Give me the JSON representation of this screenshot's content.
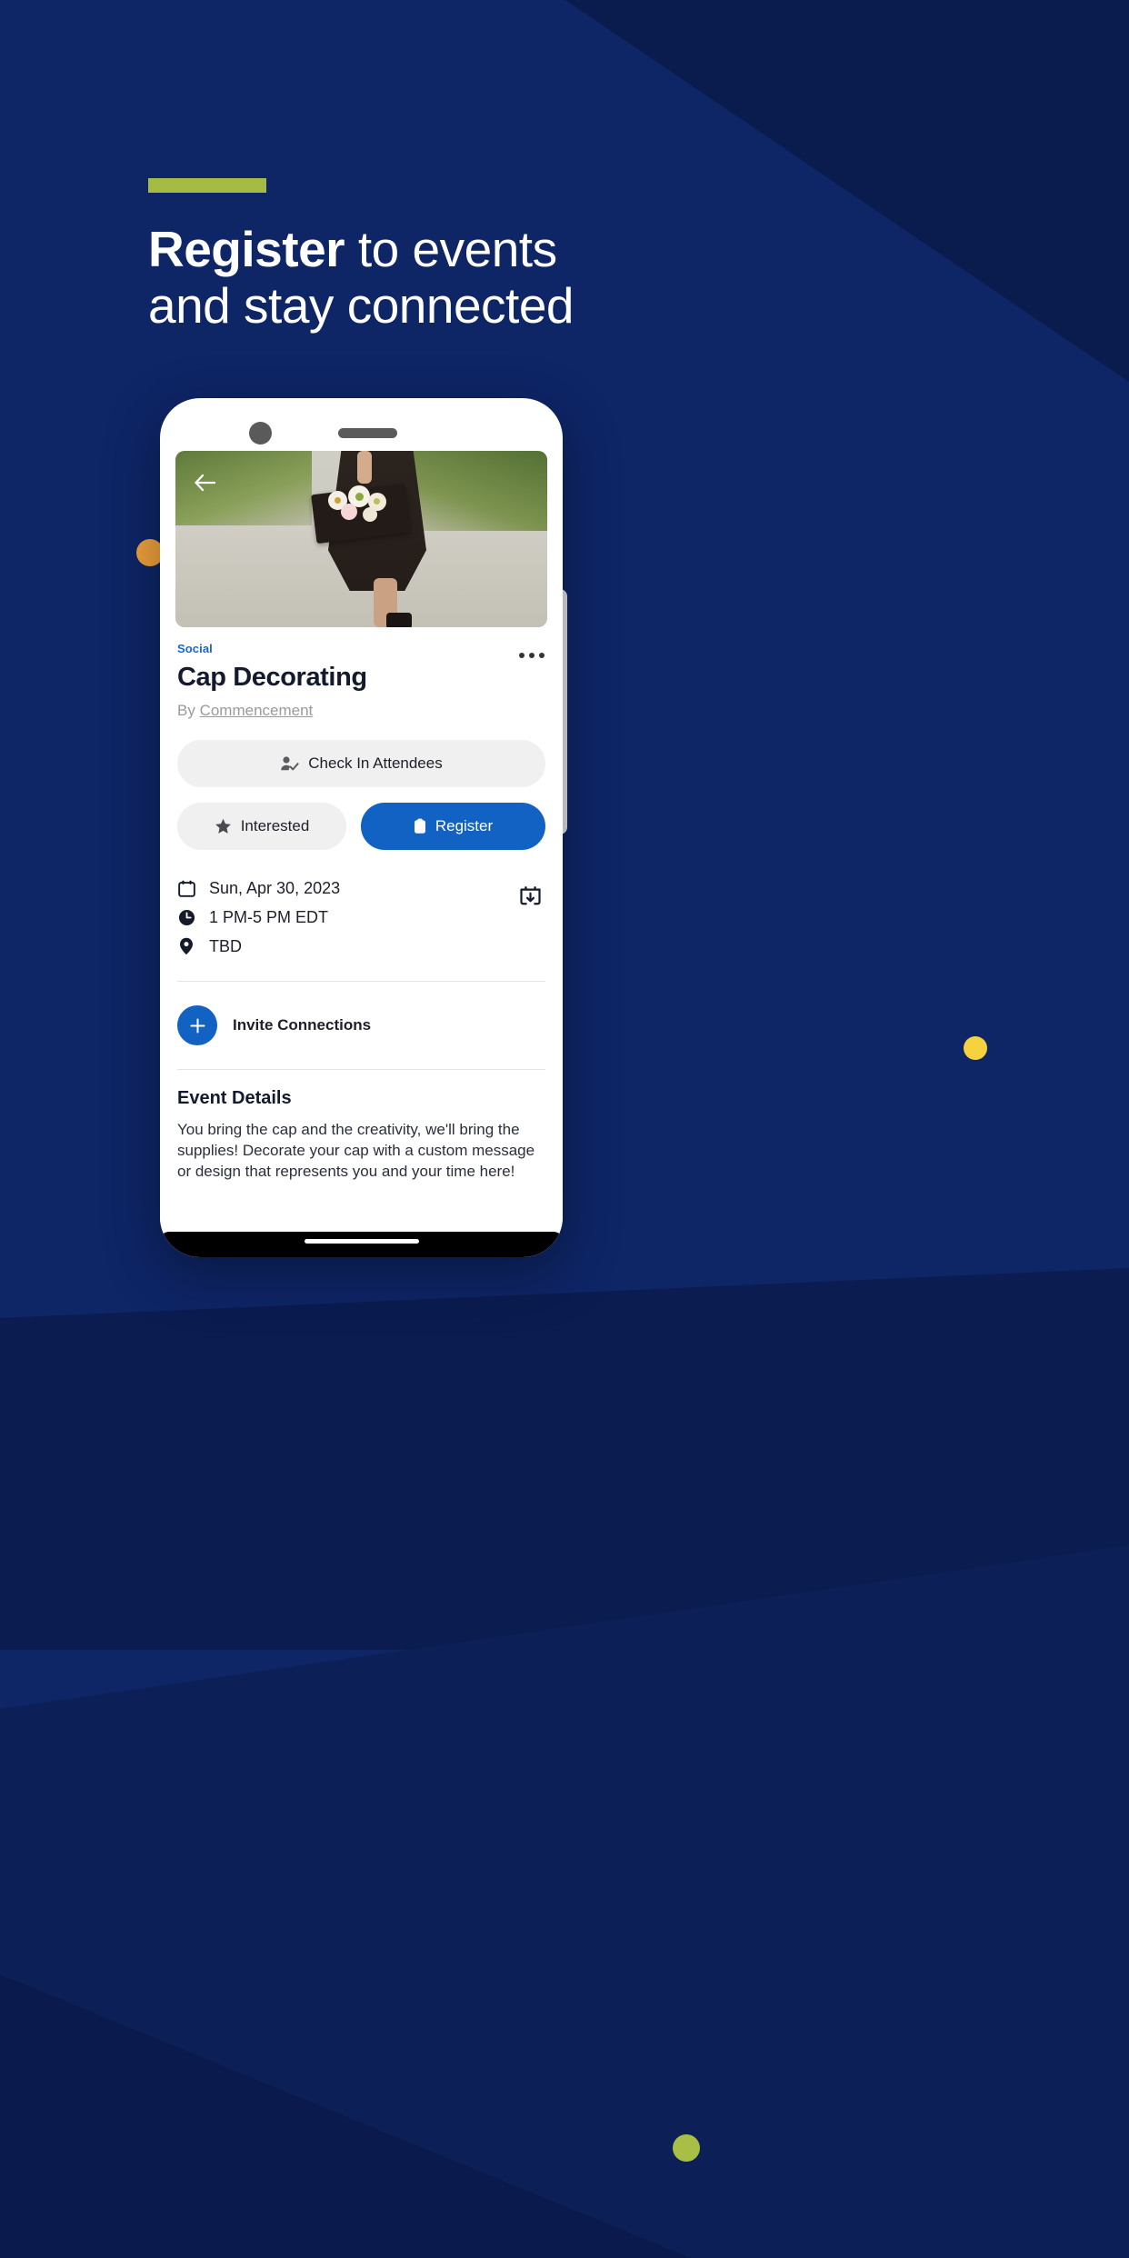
{
  "theme": {
    "background_navy": "#0e2566",
    "accent_green": "#a4bb44",
    "accent_orange": "#eda03c",
    "accent_yellow": "#f6d23e",
    "brand_blue": "#1262c4",
    "category_blue": "#1a66c9"
  },
  "headline": {
    "bold_word": "Register",
    "rest_line1": " to events",
    "line2": "and stay connected"
  },
  "phone": {
    "hero": {
      "back_icon": "arrow-left-icon",
      "image_alt": "graduate holding flower-decorated cap on a road"
    },
    "event": {
      "category": "Social",
      "title": "Cap Decorating",
      "by_prefix": "By ",
      "by_org": "Commencement",
      "more_icon": "ellipsis-icon"
    },
    "actions": {
      "check_in": "Check In Attendees",
      "check_in_icon": "person-check-icon",
      "interested": "Interested",
      "interested_icon": "star-icon",
      "register": "Register",
      "register_icon": "ticket-icon"
    },
    "meta": {
      "date": "Sun, Apr 30, 2023",
      "date_icon": "calendar-icon",
      "time": "1 PM-5 PM EDT",
      "time_icon": "clock-icon",
      "location": "TBD",
      "location_icon": "location-pin-icon",
      "add_to_calendar_icon": "calendar-download-icon"
    },
    "invite": {
      "label": "Invite Connections",
      "icon": "plus-icon"
    },
    "details": {
      "heading": "Event Details",
      "body": "You bring the cap and the creativity, we'll bring the supplies! Decorate your cap with a custom message or design that represents you and your time here!"
    }
  }
}
